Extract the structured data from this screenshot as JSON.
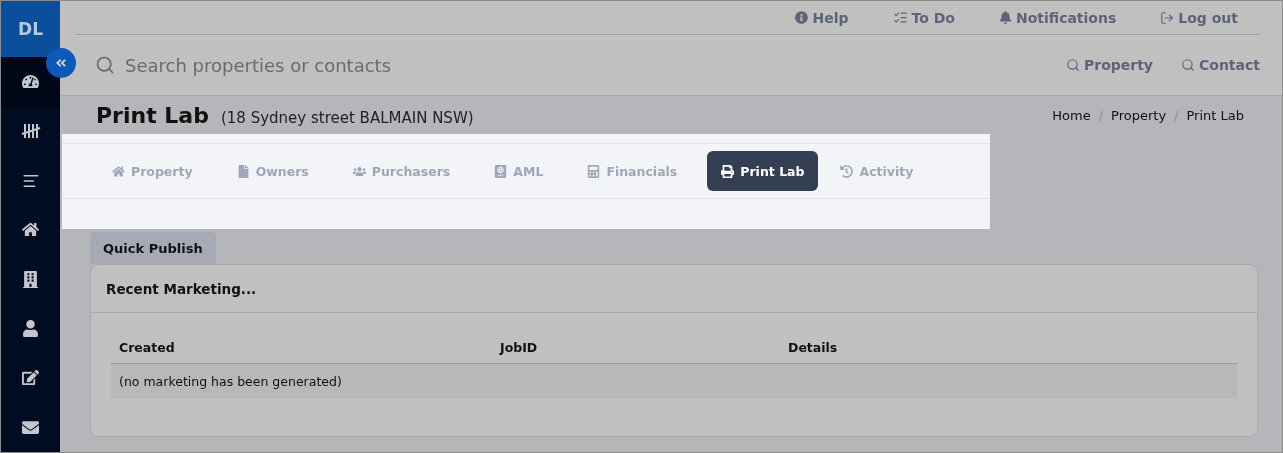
{
  "sidebar": {
    "avatar": "DL",
    "items": [
      {
        "kind": "dashboard",
        "selected": true
      },
      {
        "kind": "tally",
        "selected": false
      },
      {
        "kind": "list",
        "selected": false
      },
      {
        "kind": "home",
        "selected": false
      },
      {
        "kind": "building",
        "selected": false
      },
      {
        "kind": "user",
        "selected": false
      },
      {
        "kind": "edit",
        "selected": false
      },
      {
        "kind": "mail",
        "selected": false
      }
    ]
  },
  "top_links": [
    {
      "kind": "help",
      "label": "Help"
    },
    {
      "kind": "todo",
      "label": "To Do"
    },
    {
      "kind": "bell",
      "label": "Notifications"
    },
    {
      "kind": "logout",
      "label": "Log out"
    }
  ],
  "search": {
    "placeholder": "Search properties or contacts",
    "quick_search": [
      "Property",
      "Contact"
    ]
  },
  "page": {
    "title": "Print Lab",
    "subtitle": "(18 Sydney street BALMAIN NSW)",
    "breadcrumb": [
      "Home",
      "Property",
      "Print Lab"
    ],
    "breadcrumb_separator": "/"
  },
  "tabs": [
    {
      "kind": "home",
      "label": "Property",
      "selected": false
    },
    {
      "kind": "file",
      "label": "Owners",
      "selected": false
    },
    {
      "kind": "users",
      "label": "Purchasers",
      "selected": false
    },
    {
      "kind": "passport",
      "label": "AML",
      "selected": false
    },
    {
      "kind": "calculator",
      "label": "Financials",
      "selected": false
    },
    {
      "kind": "print",
      "label": "Print Lab",
      "selected": true
    },
    {
      "kind": "history",
      "label": "Activity",
      "selected": false
    }
  ],
  "subtabs": [
    {
      "label": "Quick Publish",
      "selected": true
    }
  ],
  "card": {
    "title": "Recent Marketing...",
    "table": {
      "columns": [
        "Created",
        "JobID",
        "Details"
      ],
      "empty_text": "(no marketing has been generated)"
    }
  }
}
